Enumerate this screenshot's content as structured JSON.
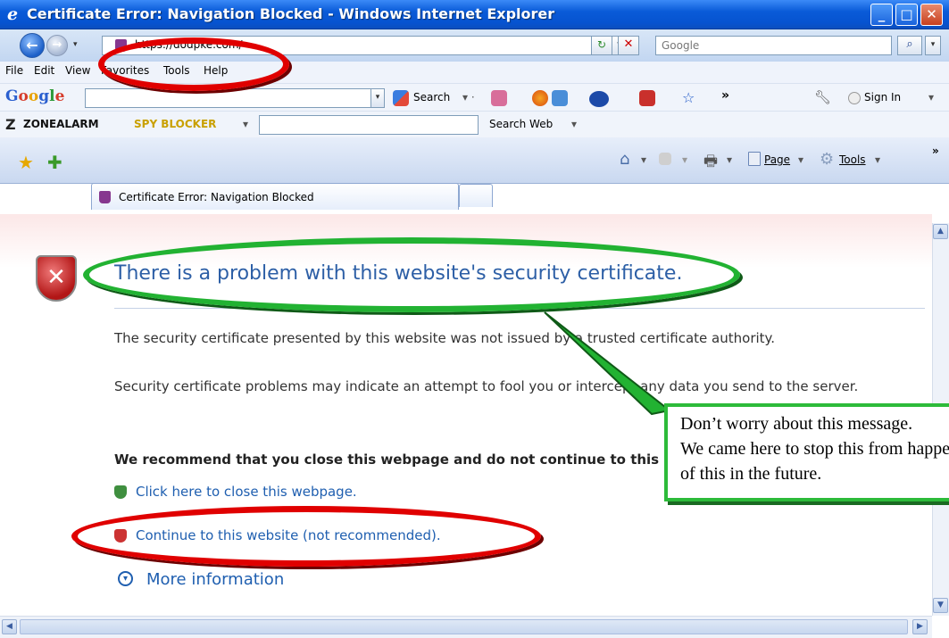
{
  "window": {
    "title": "Certificate Error: Navigation Blocked - Windows Internet Explorer",
    "controls": {
      "minimize": "_",
      "maximize": "□",
      "close": "✕"
    }
  },
  "address_bar": {
    "url": "https://dodpke.com/",
    "search_placeholder": "Google"
  },
  "menu": [
    "File",
    "Edit",
    "View",
    "Favorites",
    "Tools",
    "Help"
  ],
  "google_toolbar": {
    "logo": "Google",
    "search_label": "Search",
    "more": "»",
    "sign_in": "Sign In"
  },
  "zonealarm": {
    "brand": "ZoneAlarm",
    "product": "Spy Blocker",
    "search_web": "Search Web"
  },
  "tabs": {
    "active_label": "Certificate Error: Navigation Blocked",
    "page_label": "Page",
    "tools_label": "Tools"
  },
  "content": {
    "heading": "There is a problem with this website's security certificate.",
    "para1": "The security certificate presented by this website was not issued by a trusted certificate authority.",
    "para2": "Security certificate problems may indicate an attempt to fool you or intercept any data you send to the server.",
    "recommend": "We recommend that you close this webpage and do not continue to this website.",
    "close_link": "Click here to close this webpage.",
    "continue_link": "Continue to this website (not recommended).",
    "more_info": "More information"
  },
  "annotation": {
    "line1": "Don’t worry about this message.",
    "line2": "We came here to stop this from happening",
    "line3": "of this in the future."
  },
  "colors": {
    "highlight_red": "#e00000",
    "highlight_green": "#22b232",
    "link_blue": "#1f5fb0",
    "heading_blue": "#2d5fa6"
  }
}
